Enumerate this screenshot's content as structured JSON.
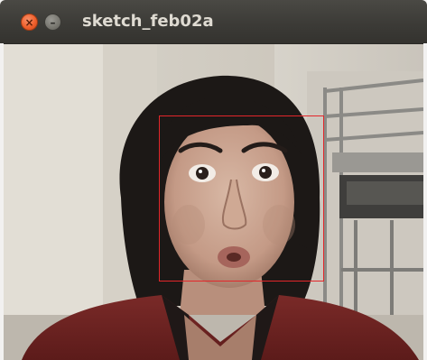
{
  "window": {
    "title": "sketch_feb02a",
    "buttons": [
      {
        "name": "close",
        "glyph": "×",
        "color": "#f0602c"
      },
      {
        "name": "minimize",
        "glyph": "–",
        "color": "#77766f"
      }
    ]
  },
  "camera": {
    "detection_box_color": "#e3262a"
  },
  "icons": [
    "close-icon",
    "minimize-icon"
  ]
}
